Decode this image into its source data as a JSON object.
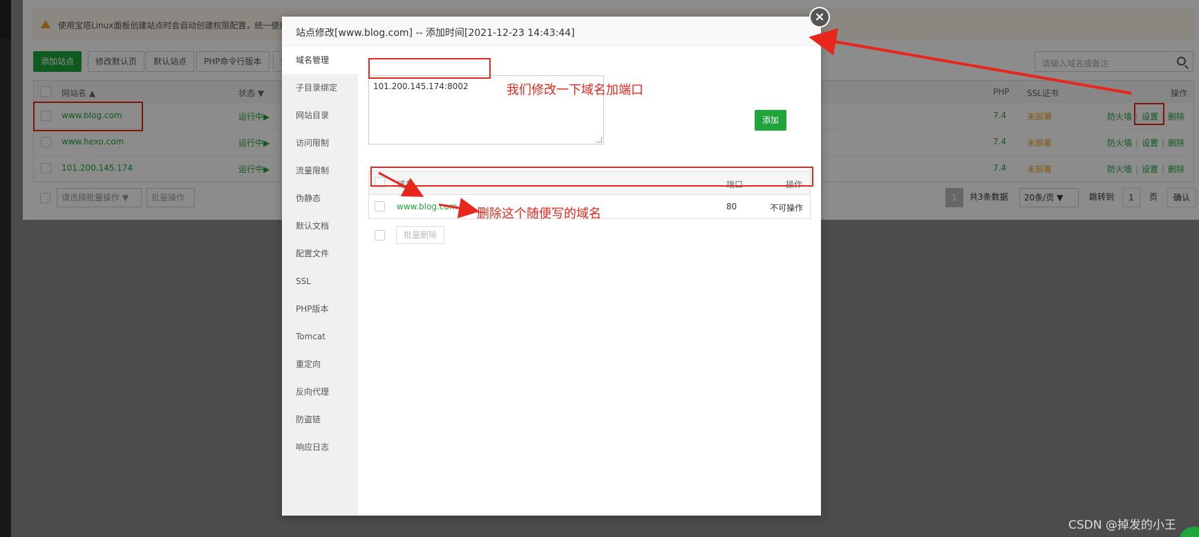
{
  "notice": {
    "text": "使用宝塔Linux面板创建站点时会自动创建权限配置，统一使用"
  },
  "toolbar": {
    "buttons": [
      "添加站点",
      "修改默认页",
      "默认站点",
      "PHP命令行版本",
      "安"
    ]
  },
  "search": {
    "placeholder": "请输入域名或备注"
  },
  "site_table": {
    "headers": {
      "name": "网站名 ▲",
      "status": "状态 ▼",
      "php": "PHP",
      "ssl": "SSL证书",
      "actions": "操作"
    },
    "rows": [
      {
        "name": "www.blog.com",
        "status": "运行中▶",
        "php": "7.4",
        "ssl": "未部署",
        "firewall": "防火墙",
        "settings": "设置",
        "delete": "删除"
      },
      {
        "name": "www.hexo.com",
        "status": "运行中▶",
        "php": "7.4",
        "ssl": "未部署",
        "firewall": "防火墙",
        "settings": "设置",
        "delete": "删除"
      },
      {
        "name": "101.200.145.174",
        "status": "运行中▶",
        "php": "7.4",
        "ssl": "未部署",
        "firewall": "防火墙",
        "settings": "设置",
        "delete": "删除"
      }
    ]
  },
  "bottom_bar": {
    "batch_select": "请选择批量操作 ▼",
    "batch_button": "批量操作",
    "page": "1",
    "total": "共3条数据",
    "per_page": "20条/页 ▼",
    "jump_label": "跳转到",
    "jump_value": "1",
    "page_unit": "页",
    "confirm": "确认"
  },
  "modal": {
    "title": "站点修改[www.blog.com] -- 添加时间[2021-12-23 14:43:44]",
    "close": "×",
    "menu": [
      "域名管理",
      "子目录绑定",
      "网站目录",
      "访问限制",
      "流量限制",
      "伪静态",
      "默认文档",
      "配置文件",
      "SSL",
      "PHP版本",
      "Tomcat",
      "重定向",
      "反向代理",
      "防盗链",
      "响应日志"
    ],
    "domain_input": "101.200.145.174:8002",
    "add_button": "添加",
    "domain_table": {
      "headers": {
        "domain": "域名",
        "port": "端口",
        "action": "操作"
      },
      "rows": [
        {
          "domain": "www.blog.com",
          "port": "80",
          "action": "不可操作"
        }
      ]
    },
    "batch_delete": "批量删除"
  },
  "annotations": {
    "note1": "我们修改一下域名加端口",
    "note2": "删除这个随便写的域名",
    "color": "#e8261c"
  },
  "watermark": "CSDN @掉发的小王"
}
